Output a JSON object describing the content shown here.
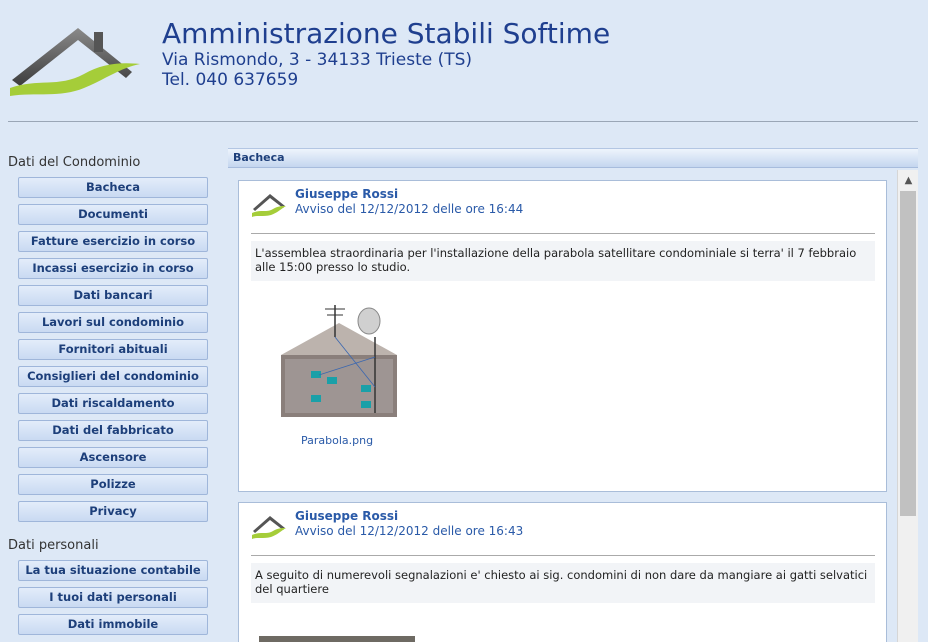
{
  "header": {
    "title": "Amministrazione Stabili Softime",
    "address": "Via Rismondo, 3 - 34133 Trieste (TS)",
    "phone": "Tel. 040 637659"
  },
  "sidebar": {
    "section1_title": "Dati del Condominio",
    "section1_items": [
      "Bacheca",
      "Documenti",
      "Fatture esercizio in corso",
      "Incassi esercizio in corso",
      "Dati bancari",
      "Lavori sul condominio",
      "Fornitori abituali",
      "Consiglieri del condominio",
      "Dati riscaldamento",
      "Dati del fabbricato",
      "Ascensore",
      "Polizze",
      "Privacy"
    ],
    "section2_title": "Dati personali",
    "section2_items": [
      "La tua situazione contabile",
      "I tuoi dati personali",
      "Dati immobile"
    ]
  },
  "panel": {
    "title": "Bacheca",
    "posts": [
      {
        "author": "Giuseppe Rossi",
        "date": "Avviso del 12/12/2012 delle ore 16:44",
        "text": "L'assemblea straordinaria per l'installazione della parabola satellitare condominiale si terra' il 7 febbraio alle 15:00 presso lo studio.",
        "attachment": "Parabola.png"
      },
      {
        "author": "Giuseppe Rossi",
        "date": "Avviso del 12/12/2012 delle ore 16:43",
        "text": "A seguito di numerevoli segnalazioni e' chiesto ai sig. condomini di non dare da mangiare ai gatti selvatici del quartiere"
      }
    ]
  },
  "colors": {
    "brand_blue": "#1f3f8f",
    "brand_green": "#9acd32",
    "page_bg": "#dde8f6"
  }
}
